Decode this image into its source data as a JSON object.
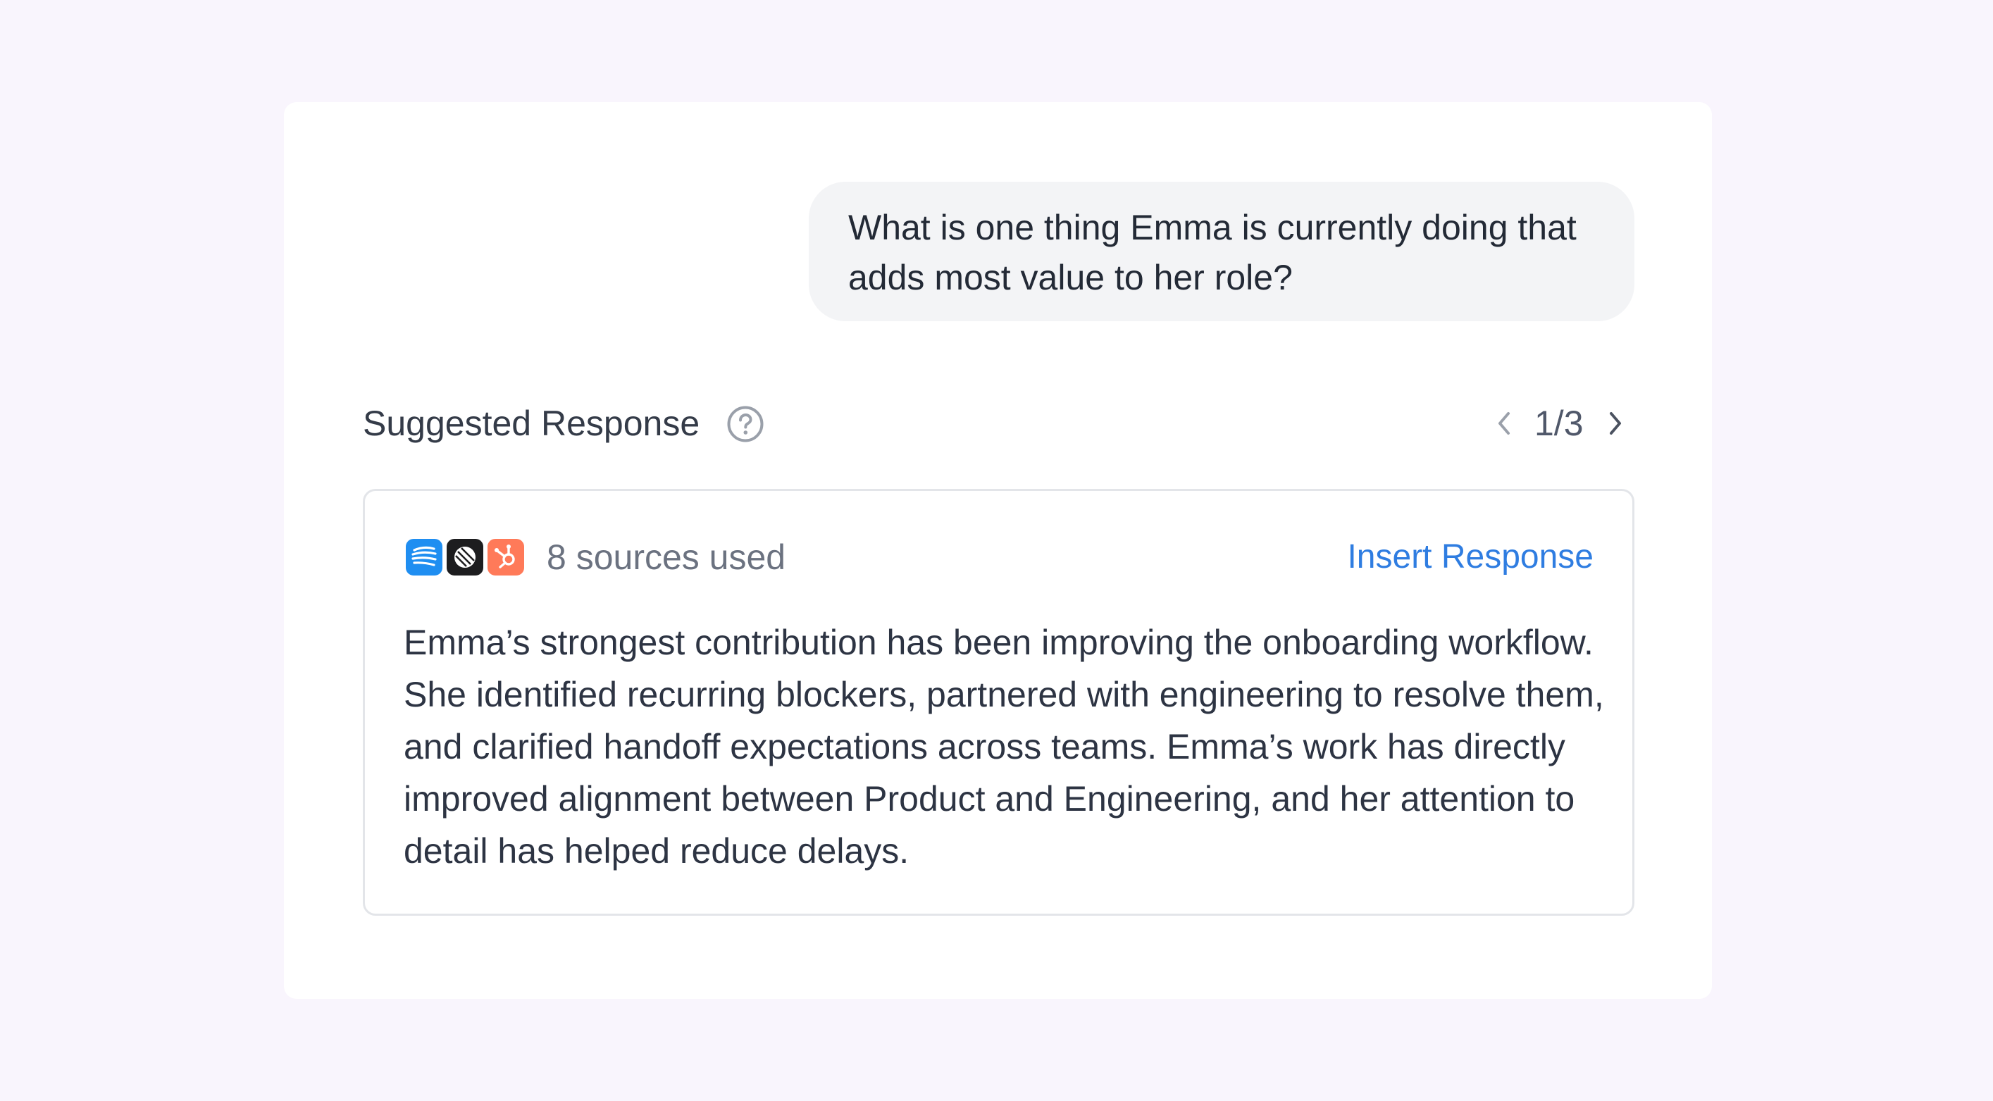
{
  "question": {
    "text": "What is one thing Emma is currently doing that adds most value to her role?"
  },
  "suggested_response": {
    "title": "Suggested Response",
    "help_icon": "question-circle-icon",
    "pager": {
      "label": "1/3",
      "prev_icon": "chevron-left-icon",
      "next_icon": "chevron-right-icon"
    },
    "sources": {
      "icons": [
        "source-app-blue-icon",
        "source-app-dark-icon",
        "hubspot-icon"
      ],
      "label": "8 sources used"
    },
    "insert_label": "Insert Response",
    "body": "Emma’s strongest contribution has been improving the onboarding workflow. She identified recurring blockers, partnered with engineering to resolve them, and clarified handoff expectations across teams. Emma’s work has directly improved alignment between Product and Engineering, and her attention to detail has helped reduce delays."
  },
  "colors": {
    "page_background": "#f9f5fd",
    "card_background": "#ffffff",
    "bubble_background": "#f3f4f6",
    "accent_link": "#2f7de1",
    "source_blue": "#1f8ef1",
    "source_dark": "#1d1d1f",
    "source_orange": "#ff7a59"
  }
}
